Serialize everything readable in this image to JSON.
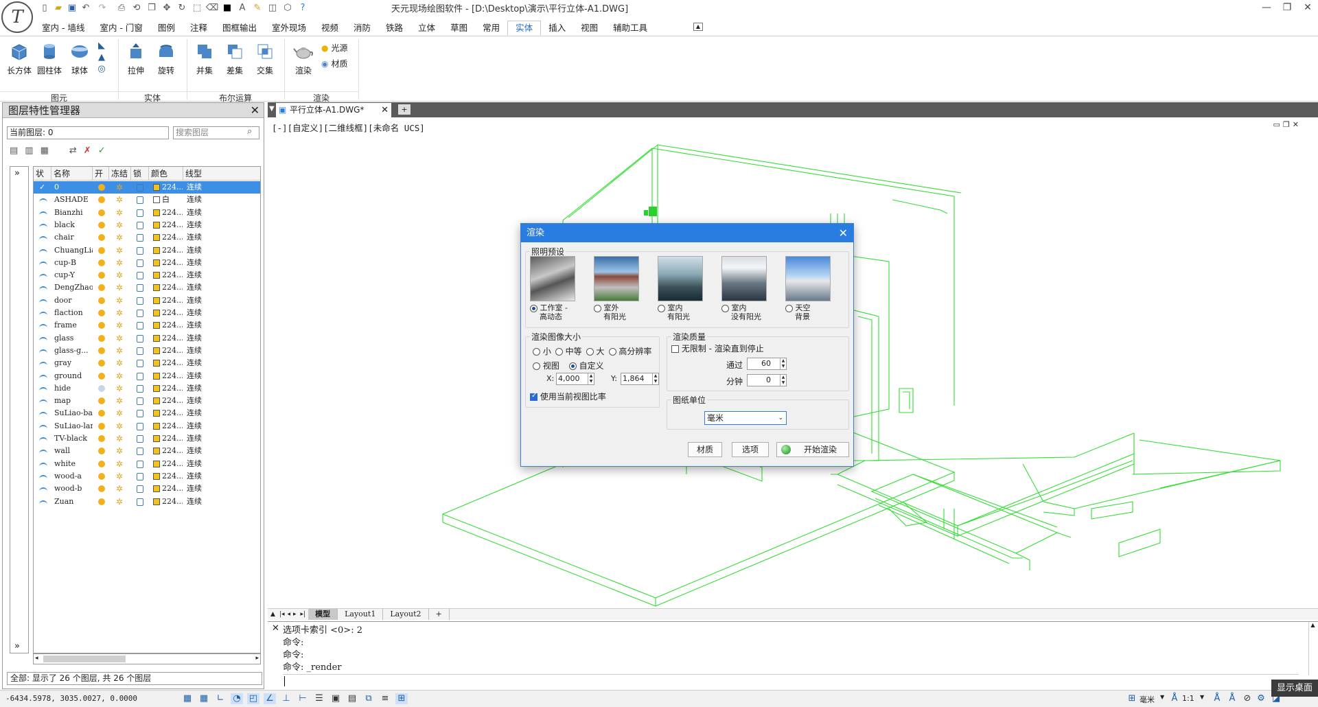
{
  "app": {
    "title": "天元现场绘图软件 - [D:\\Desktop\\演示\\平行立体-A1.DWG]"
  },
  "menu": {
    "tabs": [
      "室内 - 墙线",
      "室内 - 门窗",
      "图例",
      "注释",
      "图框输出",
      "室外现场",
      "视频",
      "消防",
      "铁路",
      "立体",
      "草图",
      "常用",
      "实体",
      "插入",
      "视图",
      "辅助工具"
    ],
    "active": "实体"
  },
  "ribbon": {
    "box": "长方体",
    "cylinder": "圆柱体",
    "sphere": "球体",
    "extrude": "拉伸",
    "revolve": "旋转",
    "union": "并集",
    "subtract": "差集",
    "intersect": "交集",
    "render": "渲染",
    "light": "光源",
    "material": "材质",
    "groups": {
      "primitives": "图元",
      "solids": "实体",
      "boolean": "布尔运算",
      "render": "渲染"
    }
  },
  "layer_panel": {
    "title": "图层特性管理器",
    "current_layer": "当前图层: 0",
    "search_placeholder": "搜索图层",
    "columns": [
      "状态",
      "名称",
      "开",
      "冻结",
      "锁定",
      "颜色",
      "线型"
    ],
    "rows": [
      {
        "name": "0",
        "color": "224...",
        "linetype": "连续"
      },
      {
        "name": "ASHADE",
        "color": "白",
        "linetype": "连续"
      },
      {
        "name": "Bianzhi",
        "color": "224...",
        "linetype": "连续"
      },
      {
        "name": "black",
        "color": "224...",
        "linetype": "连续"
      },
      {
        "name": "chair",
        "color": "224...",
        "linetype": "连续"
      },
      {
        "name": "ChuangLian",
        "color": "224...",
        "linetype": "连续"
      },
      {
        "name": "cup-B",
        "color": "224...",
        "linetype": "连续"
      },
      {
        "name": "cup-Y",
        "color": "224...",
        "linetype": "连续"
      },
      {
        "name": "DengZhao",
        "color": "224...",
        "linetype": "连续"
      },
      {
        "name": "door",
        "color": "224...",
        "linetype": "连续"
      },
      {
        "name": "flaction",
        "color": "224...",
        "linetype": "连续"
      },
      {
        "name": "frame",
        "color": "224...",
        "linetype": "连续"
      },
      {
        "name": "glass",
        "color": "224...",
        "linetype": "连续"
      },
      {
        "name": "glass-g...",
        "color": "224...",
        "linetype": "连续"
      },
      {
        "name": "gray",
        "color": "224...",
        "linetype": "连续"
      },
      {
        "name": "ground",
        "color": "224...",
        "linetype": "连续"
      },
      {
        "name": "hide",
        "color": "224...",
        "linetype": "连续"
      },
      {
        "name": "map",
        "color": "224...",
        "linetype": "连续"
      },
      {
        "name": "SuLiao-bai",
        "color": "224...",
        "linetype": "连续"
      },
      {
        "name": "SuLiao-lan",
        "color": "224...",
        "linetype": "连续"
      },
      {
        "name": "TV-black",
        "color": "224...",
        "linetype": "连续"
      },
      {
        "name": "wall",
        "color": "224...",
        "linetype": "连续"
      },
      {
        "name": "white",
        "color": "224...",
        "linetype": "连续"
      },
      {
        "name": "wood-a",
        "color": "224...",
        "linetype": "连续"
      },
      {
        "name": "wood-b",
        "color": "224...",
        "linetype": "连续"
      },
      {
        "name": "Zuan",
        "color": "224...",
        "linetype": "连续"
      }
    ],
    "status": "全部: 显示了 26 个图层, 共 26 个图层",
    "expand": "»"
  },
  "document": {
    "tab": "平行立体-A1.DWG*",
    "view_label": "[-][自定义][二维线框][未命名 UCS]"
  },
  "layouts": [
    "模型",
    "Layout1",
    "Layout2",
    "+"
  ],
  "command": {
    "lines": [
      "选项卡索引 <0>: 2",
      "命令:",
      "命令:",
      "命令: _render"
    ]
  },
  "statusbar": {
    "coords": "-6434.5978, 3035.0027, 0.0000",
    "unit": "毫米",
    "scale": "1:1",
    "tooltip": "显示桌面"
  },
  "dialog": {
    "title": "渲染",
    "lighting_legend": "照明预设",
    "presets": [
      {
        "l1": "工作室 -",
        "l2": "高动态",
        "on": true
      },
      {
        "l1": "室外",
        "l2": "有阳光",
        "on": false
      },
      {
        "l1": "室内",
        "l2": "有阳光",
        "on": false
      },
      {
        "l1": "室内",
        "l2": "没有阳光",
        "on": false
      },
      {
        "l1": "天空",
        "l2": "背景",
        "on": false
      }
    ],
    "size_legend": "渲染图像大小",
    "size_small": "小",
    "size_medium": "中等",
    "size_large": "大",
    "size_hires": "高分辨率",
    "size_view": "视图",
    "size_custom": "自定义",
    "x_label": "X:",
    "x_value": "4,000",
    "y_label": "Y:",
    "y_value": "1,864",
    "use_ratio": "使用当前视图比率",
    "quality_legend": "渲染质量",
    "unlimited": "无限制 - 渲染直到停止",
    "pass_label": "通过",
    "pass_value": "60",
    "minute_label": "分钟",
    "minute_value": "0",
    "units_legend": "图纸单位",
    "units_value": "毫米",
    "btn_material": "材质",
    "btn_options": "选项",
    "btn_start": "开始渲染"
  },
  "colors": {
    "accent": "#2a7de0",
    "wire": "#33dd33",
    "selected_row": "#3d8fe6"
  }
}
